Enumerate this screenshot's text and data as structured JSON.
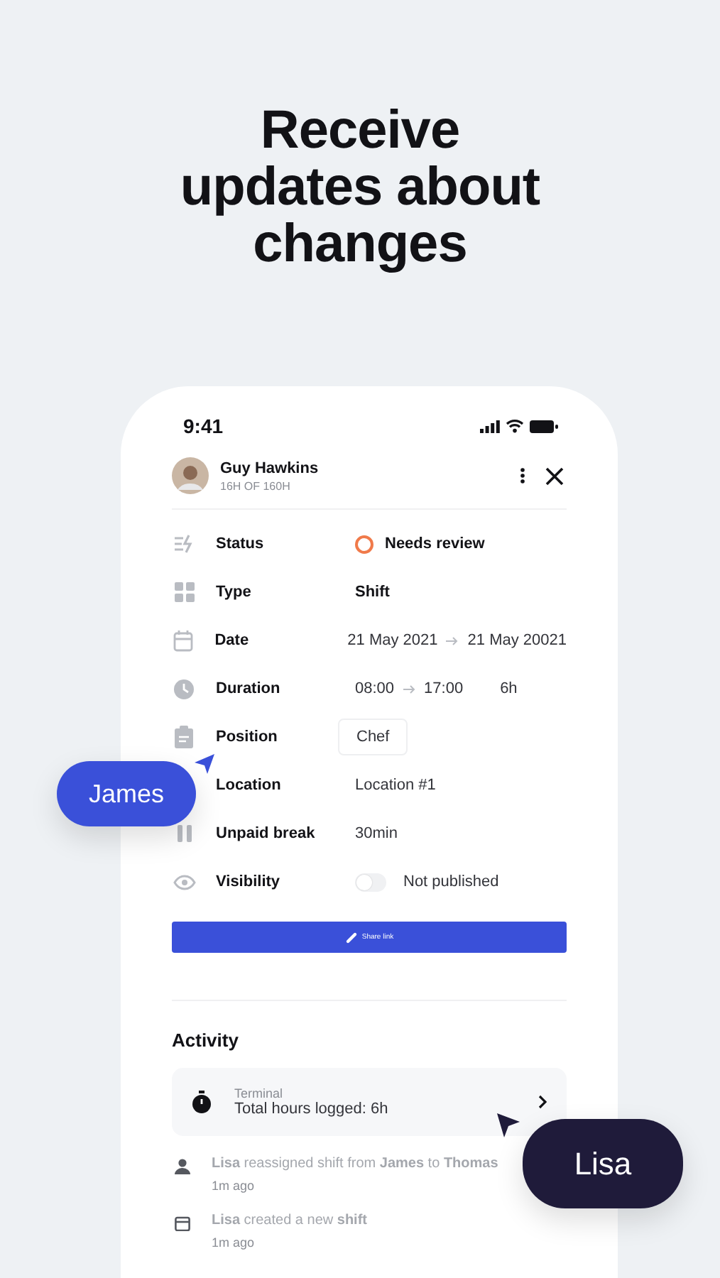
{
  "headline": [
    "Receive",
    "updates about",
    "changes"
  ],
  "status_bar": {
    "time": "9:41"
  },
  "header": {
    "name": "Guy Hawkins",
    "hours": "16H OF 160H"
  },
  "fields": [
    {
      "kind": "status",
      "label": "Status",
      "value": "Needs review"
    },
    {
      "kind": "text",
      "label": "Type",
      "value": "Shift",
      "bold": true
    },
    {
      "kind": "range",
      "label": "Date",
      "from": "21 May 2021",
      "to": "21 May 20021"
    },
    {
      "kind": "range",
      "label": "Duration",
      "from": "08:00",
      "to": "17:00",
      "extra": "6h"
    },
    {
      "kind": "chip",
      "label": "Position",
      "value": "Chef"
    },
    {
      "kind": "text",
      "label": "Location",
      "value": "Location #1",
      "bold": false
    },
    {
      "kind": "text",
      "label": "Unpaid break",
      "value": "30min",
      "bold": false
    },
    {
      "kind": "toggle",
      "label": "Visibility",
      "value": "Not published",
      "on": false
    }
  ],
  "share_button": "Share link",
  "activity": {
    "title": "Activity",
    "card": {
      "source": "Terminal",
      "text": "Total hours logged: 6h"
    },
    "entries": [
      {
        "text": "**Lisa** reassigned shift from **James** to **Thomas**",
        "time": "1m ago"
      },
      {
        "text": "**Lisa** created a new **shift**",
        "time": "1m ago"
      }
    ]
  },
  "cursors": [
    {
      "label": "James",
      "color": "#3a50d9"
    },
    {
      "label": "Lisa",
      "color": "#1f1b3a"
    }
  ]
}
